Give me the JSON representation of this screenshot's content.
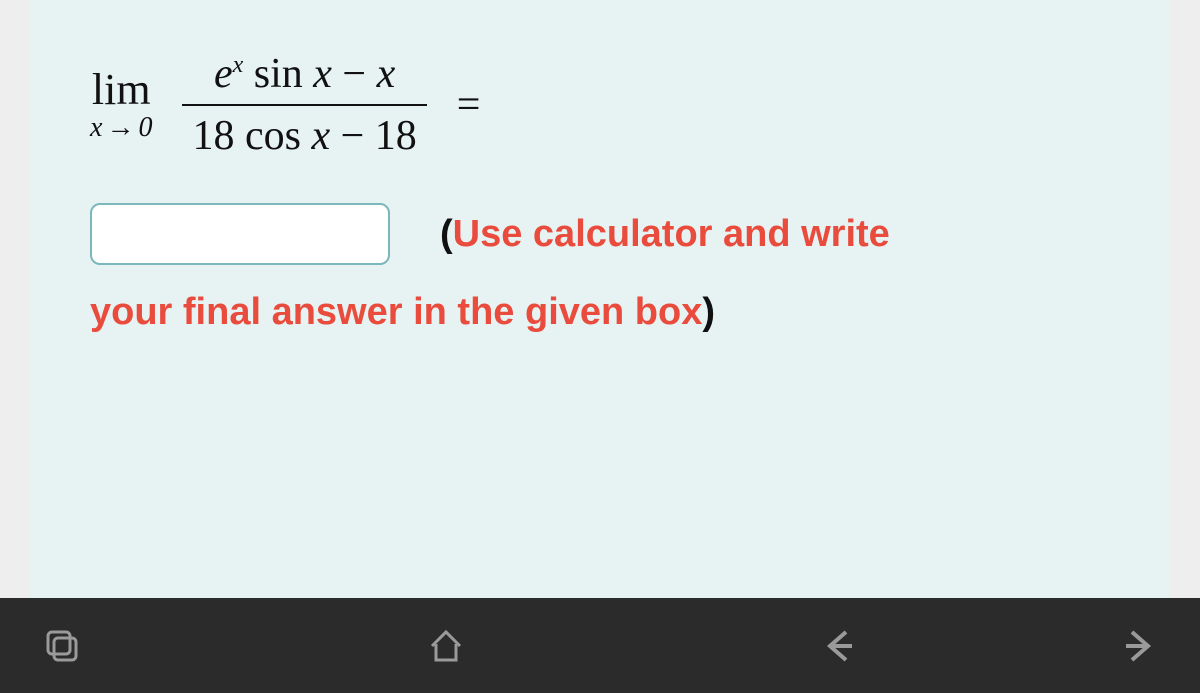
{
  "equation": {
    "lim_word": "lim",
    "lim_var": "x",
    "lim_arrow": "→",
    "lim_target": "0",
    "numerator_e": "e",
    "numerator_exp": "x",
    "numerator_sin": " sin ",
    "numerator_x1": "x",
    "numerator_minus": " − ",
    "numerator_x2": "x",
    "denominator_18a": "18",
    "denominator_cos": " cos ",
    "denominator_x": "x",
    "denominator_minus": " − ",
    "denominator_18b": "18",
    "equals": "="
  },
  "input": {
    "value": ""
  },
  "hint": {
    "open_paren": "(",
    "line1": "Use calculator and write",
    "line2": "your final answer in the given box",
    "close_paren": ")"
  },
  "nav": {
    "tabs_label": "tabs",
    "home_label": "home",
    "back_label": "back",
    "forward_label": "forward"
  }
}
